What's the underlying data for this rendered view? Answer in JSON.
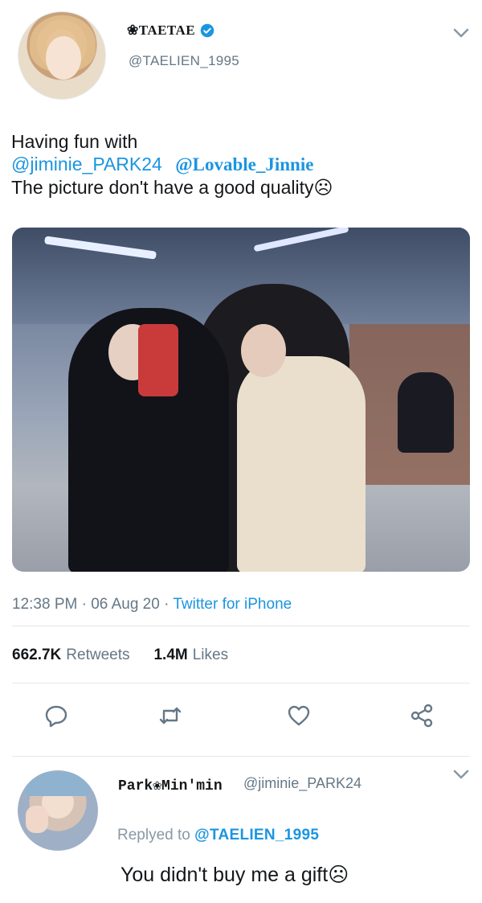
{
  "tweet": {
    "author": {
      "display_name": "❀TAETAE",
      "handle": "@TAELIEN_1995",
      "verified": true
    },
    "text_line1": "Having fun with",
    "mention1": "@jiminie_PARK24",
    "mention2": "@Lovable_Jinnie",
    "text_line3": "The picture don't have a good quality☹",
    "time": "12:38 PM",
    "date": "06 Aug 20",
    "separator": "·",
    "source": "Twitter for iPhone",
    "retweets_count": "662.7K",
    "retweets_label": "Retweets",
    "likes_count": "1.4M",
    "likes_label": "Likes"
  },
  "actions": {
    "reply_icon": "reply-icon",
    "retweet_icon": "retweet-icon",
    "like_icon": "heart-icon",
    "share_icon": "share-icon"
  },
  "reply": {
    "display_name": "Park❀Min'min",
    "handle": "@jiminie_PARK24",
    "replying_prefix": "Replyed to",
    "replying_to": "@TAELIEN_1995",
    "text": "You didn't buy me a gift☹"
  },
  "colors": {
    "accent": "#1b95e0",
    "muted": "#657786",
    "divider": "#e1e8ed"
  }
}
